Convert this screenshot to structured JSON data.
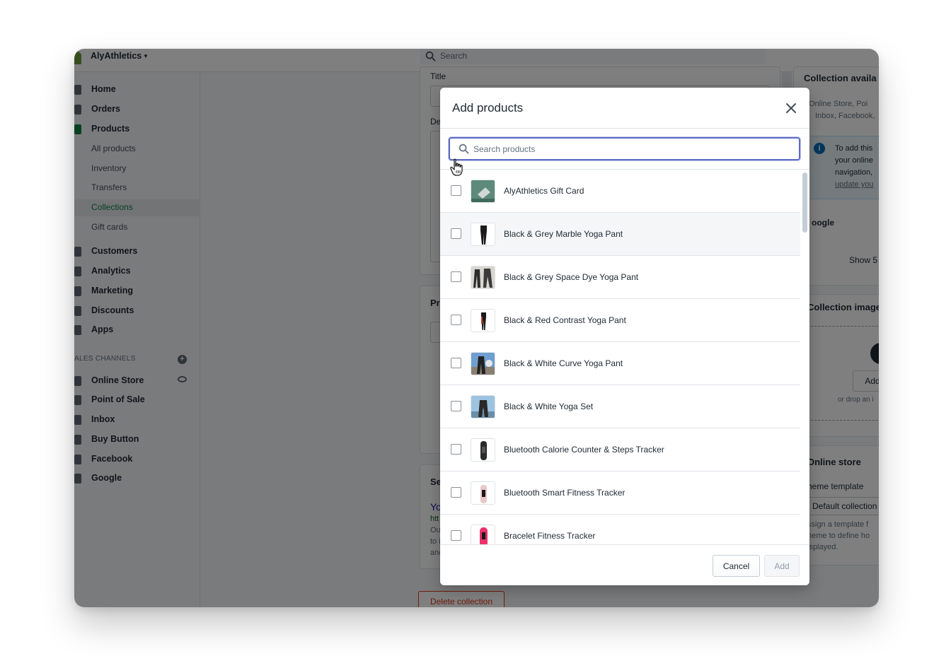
{
  "topbar": {
    "store_name": "AlyAthletics",
    "search_placeholder": "Search"
  },
  "sidebar": {
    "items": [
      {
        "label": "Home"
      },
      {
        "label": "Orders"
      },
      {
        "label": "Products"
      },
      {
        "label": "All products"
      },
      {
        "label": "Inventory"
      },
      {
        "label": "Transfers"
      },
      {
        "label": "Collections"
      },
      {
        "label": "Gift cards"
      },
      {
        "label": "Customers"
      },
      {
        "label": "Analytics"
      },
      {
        "label": "Marketing"
      },
      {
        "label": "Discounts"
      },
      {
        "label": "Apps"
      }
    ],
    "channels_label": "ALES CHANNELS",
    "channels": [
      {
        "label": "Online Store"
      },
      {
        "label": "Point of Sale"
      },
      {
        "label": "Inbox"
      },
      {
        "label": "Buy Button"
      },
      {
        "label": "Facebook"
      },
      {
        "label": "Google"
      }
    ]
  },
  "background": {
    "title_label": "Title",
    "desc_label": "De",
    "products_heading": "Pr",
    "seo_heading": "Se",
    "seo_link": "Yo",
    "seo_url": "htt",
    "seo_lines": [
      "Ou",
      "to i",
      "and"
    ],
    "collection_avail_heading": "Collection availa",
    "collection_avail_text1": "Online Store, Poi",
    "collection_avail_text2": "Inbox, Facebook,",
    "info_line1": "To add this",
    "info_line2": "your online",
    "info_line3": "navigation,",
    "info_link": "update you",
    "google_label": "oogle",
    "show_label": "Show 5",
    "collection_image_heading": "Collection image",
    "add_image_button": "Add",
    "drop_text": "or drop an i",
    "online_store_heading": "Online store",
    "theme_template_label": "heme template",
    "default_collection": "Default collection",
    "assign_line1": "ssign a template f",
    "assign_line2": "heme to define ho",
    "assign_line3": "isplayed.",
    "delete_button": "Delete collection"
  },
  "modal": {
    "title": "Add products",
    "search_placeholder": "Search products",
    "products": [
      {
        "name": "AlyAthletics Gift Card"
      },
      {
        "name": "Black & Grey Marble Yoga Pant"
      },
      {
        "name": "Black & Grey Space Dye Yoga Pant"
      },
      {
        "name": "Black & Red Contrast Yoga Pant"
      },
      {
        "name": "Black & White Curve Yoga Pant"
      },
      {
        "name": "Black & White Yoga Set"
      },
      {
        "name": "Bluetooth Calorie Counter & Steps Tracker"
      },
      {
        "name": "Bluetooth Smart Fitness Tracker"
      },
      {
        "name": "Bracelet Fitness Tracker"
      }
    ],
    "cancel_label": "Cancel",
    "add_label": "Add"
  },
  "colors": {
    "accent": "#5c6ac4",
    "active_nav": "#108043",
    "danger": "#de3618",
    "info": "#006fbb"
  }
}
